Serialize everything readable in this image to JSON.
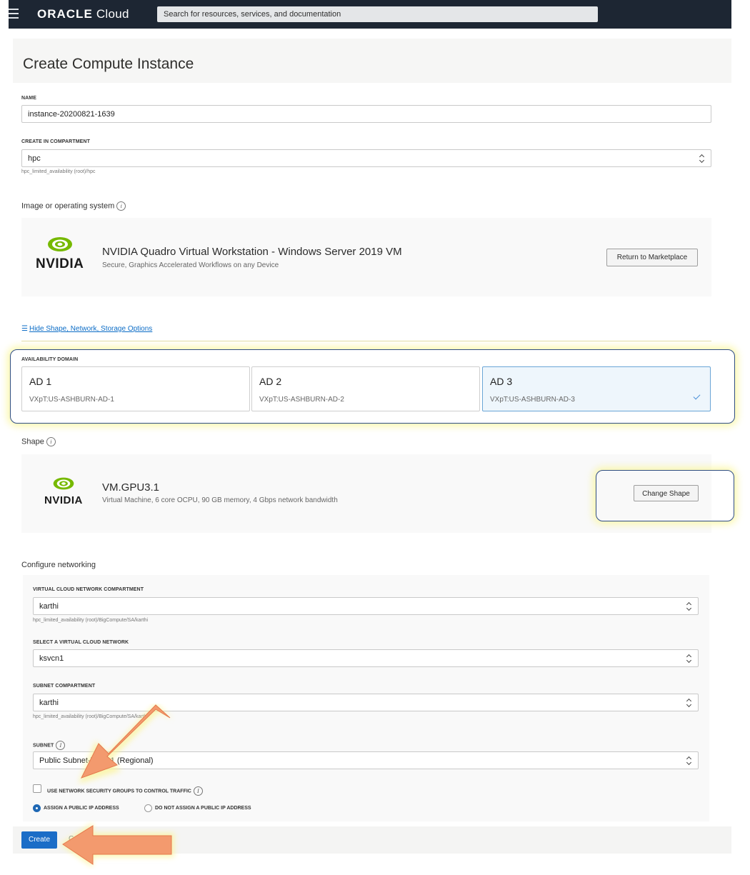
{
  "header": {
    "logo_brand": "ORACLE",
    "logo_product": "Cloud",
    "search_placeholder": "Search for resources, services, and documentation"
  },
  "page": {
    "title": "Create Compute Instance"
  },
  "name_field": {
    "label": "NAME",
    "value": "instance-20200821-1639"
  },
  "compartment": {
    "label": "CREATE IN COMPARTMENT",
    "value": "hpc",
    "hint": "hpc_limited_availability (root)/hpc"
  },
  "image": {
    "section_label": "Image or operating system",
    "logo_text": "NVIDIA",
    "title": "NVIDIA Quadro Virtual Workstation - Windows Server 2019 VM",
    "subtitle": "Secure, Graphics Accelerated Workflows on any Device",
    "button": "Return to Marketplace"
  },
  "toggle_link": "Hide Shape, Network, Storage Options",
  "availability": {
    "label": "AVAILABILITY DOMAIN",
    "domains": [
      {
        "name": "AD 1",
        "id": "VXpT:US-ASHBURN-AD-1",
        "selected": false
      },
      {
        "name": "AD 2",
        "id": "VXpT:US-ASHBURN-AD-2",
        "selected": false
      },
      {
        "name": "AD 3",
        "id": "VXpT:US-ASHBURN-AD-3",
        "selected": true
      }
    ]
  },
  "shape": {
    "section_label": "Shape",
    "logo_text": "NVIDIA",
    "title": "VM.GPU3.1",
    "subtitle": "Virtual Machine, 6 core OCPU, 90 GB memory, 4 Gbps network bandwidth",
    "button": "Change Shape"
  },
  "networking": {
    "section_label": "Configure networking",
    "vcn_compartment": {
      "label": "VIRTUAL CLOUD NETWORK COMPARTMENT",
      "value": "karthi",
      "hint": "hpc_limited_availability (root)/BigCompute/SA/karthi"
    },
    "vcn": {
      "label": "SELECT A VIRTUAL CLOUD NETWORK",
      "value": "ksvcn1"
    },
    "subnet_compartment": {
      "label": "SUBNET COMPARTMENT",
      "value": "karthi",
      "hint": "hpc_limited_availability (root)/BigCompute/SA/karthi"
    },
    "subnet": {
      "label": "SUBNET",
      "value": "Public Subnet-ksvcn1 (Regional)"
    },
    "nsg_checkbox": "USE NETWORK SECURITY GROUPS TO CONTROL TRAFFIC",
    "assign_ip": "ASSIGN A PUBLIC IP ADDRESS",
    "no_assign_ip": "DO NOT ASSIGN A PUBLIC IP ADDRESS"
  },
  "footer": {
    "create": "Create",
    "cancel": "Cancel"
  },
  "colors": {
    "accent": "#1b6dc7",
    "highlight_border": "#2f4d83",
    "arrow": "#f39a6e"
  }
}
